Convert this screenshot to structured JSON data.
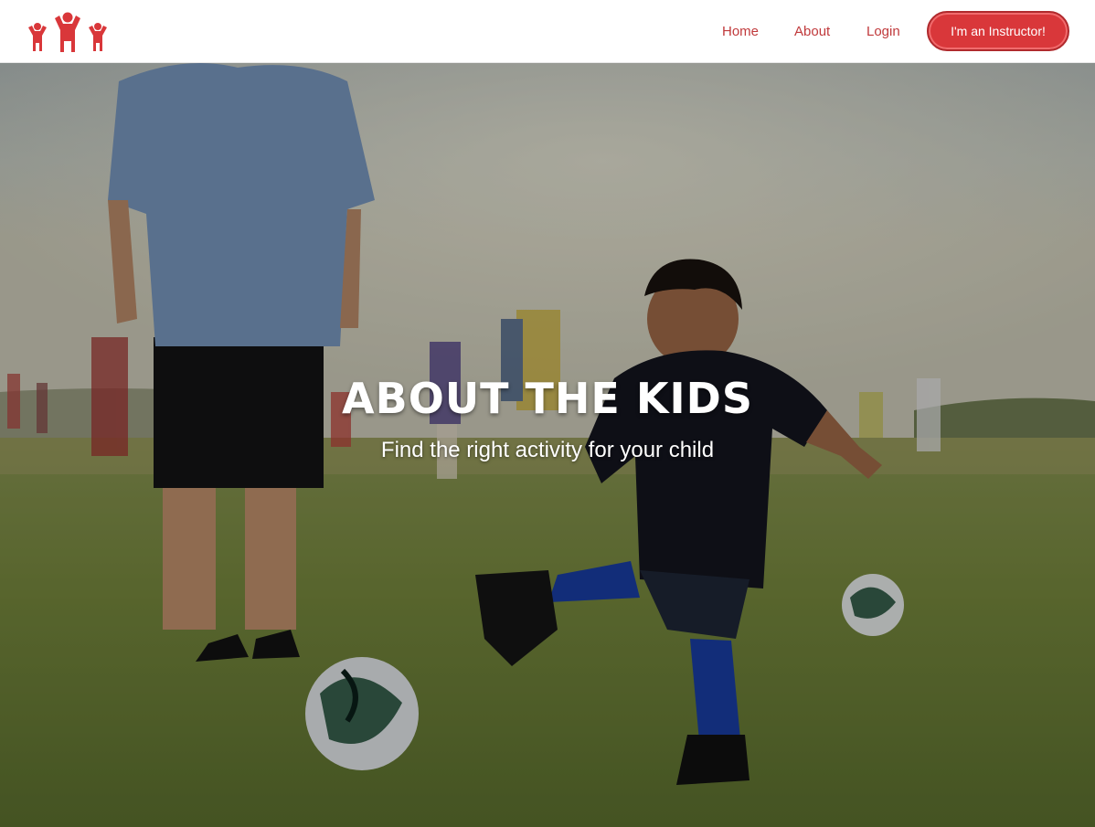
{
  "nav": {
    "logo_icon": "three-kids-logo-icon",
    "links": [
      {
        "label": "Home"
      },
      {
        "label": "About"
      },
      {
        "label": "Login"
      }
    ],
    "cta_label": "I'm an Instructor!"
  },
  "hero": {
    "title": "About the Kids",
    "subtitle": "Find the right activity for your child",
    "image": "child-kicking-soccer-ball-photo"
  },
  "colors": {
    "brand_red": "#d9373a",
    "nav_link": "#c0393b",
    "navbar_bg": "#ffffff",
    "hero_text": "#ffffff"
  }
}
